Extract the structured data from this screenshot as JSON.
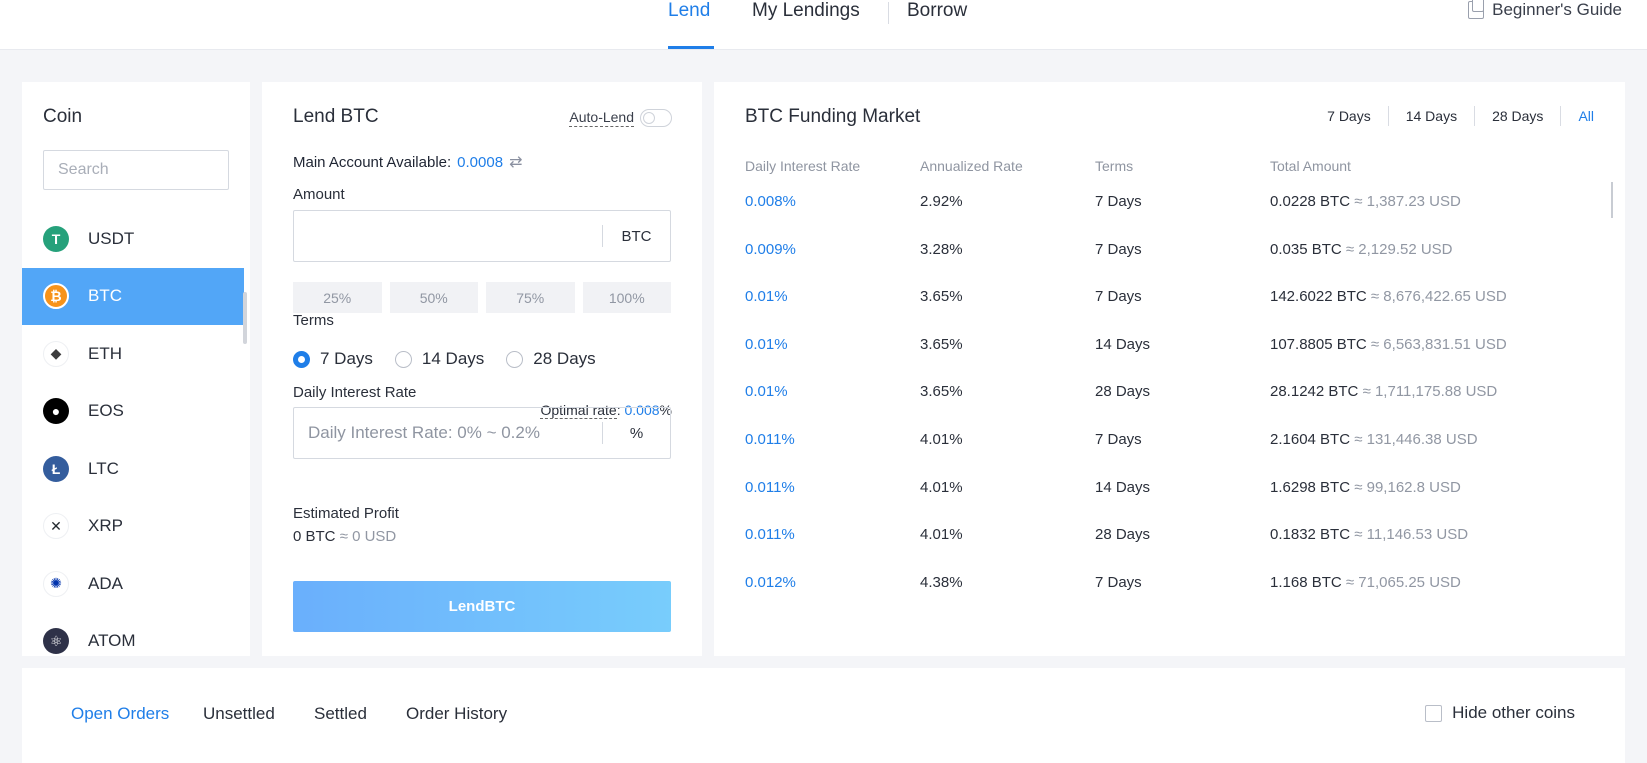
{
  "topnav": {
    "tabs": [
      {
        "label": "Lend",
        "active": true
      },
      {
        "label": "My Lendings",
        "active": false
      },
      {
        "label": "Borrow",
        "active": false
      }
    ],
    "guide_label": "Beginner's Guide"
  },
  "coins": {
    "title": "Coin",
    "search_placeholder": "Search",
    "items": [
      {
        "symbol": "USDT",
        "icon": "usdt-icon",
        "color": "#26a17b"
      },
      {
        "symbol": "BTC",
        "icon": "btc-icon",
        "color": "#f7931a",
        "active": true
      },
      {
        "symbol": "ETH",
        "icon": "eth-icon",
        "color": "#3c3c3d"
      },
      {
        "symbol": "EOS",
        "icon": "eos-icon",
        "color": "#000000"
      },
      {
        "symbol": "LTC",
        "icon": "ltc-icon",
        "color": "#345d9d"
      },
      {
        "symbol": "XRP",
        "icon": "xrp-icon",
        "color": "#23292f"
      },
      {
        "symbol": "ADA",
        "icon": "ada-icon",
        "color": "#0033ad"
      },
      {
        "symbol": "ATOM",
        "icon": "atom-icon",
        "color": "#2e3148"
      }
    ]
  },
  "lend": {
    "title": "Lend BTC",
    "autolend_label": "Auto-Lend",
    "available_label": "Main Account Available:",
    "available_value": "0.0008",
    "amount_label": "Amount",
    "amount_unit": "BTC",
    "percentages": [
      "25%",
      "50%",
      "75%",
      "100%"
    ],
    "terms_label": "Terms",
    "terms": [
      {
        "label": "7 Days",
        "checked": true
      },
      {
        "label": "14 Days",
        "checked": false
      },
      {
        "label": "28 Days",
        "checked": false
      }
    ],
    "rate_label": "Daily Interest Rate",
    "optimal_label": "Optimal rate",
    "optimal_value": "0.008",
    "rate_placeholder": "Daily Interest Rate: 0% ~ 0.2%",
    "rate_unit": "%",
    "profit_label": "Estimated Profit",
    "profit_btc": "0 BTC",
    "profit_usd": "≈ 0 USD",
    "button_label": "LendBTC"
  },
  "market": {
    "title": "BTC Funding Market",
    "ranges": [
      "7 Days",
      "14 Days",
      "28 Days",
      "All"
    ],
    "active_range": "All",
    "columns": [
      "Daily Interest Rate",
      "Annualized Rate",
      "Terms",
      "Total Amount"
    ],
    "rows": [
      {
        "daily": "0.008%",
        "annual": "2.92%",
        "term": "7 Days",
        "amount": "0.0228 BTC",
        "usd": "≈ 1,387.23 USD"
      },
      {
        "daily": "0.009%",
        "annual": "3.28%",
        "term": "7 Days",
        "amount": "0.035 BTC",
        "usd": "≈ 2,129.52 USD"
      },
      {
        "daily": "0.01%",
        "annual": "3.65%",
        "term": "7 Days",
        "amount": "142.6022 BTC",
        "usd": "≈ 8,676,422.65 USD"
      },
      {
        "daily": "0.01%",
        "annual": "3.65%",
        "term": "14 Days",
        "amount": "107.8805 BTC",
        "usd": "≈ 6,563,831.51 USD"
      },
      {
        "daily": "0.01%",
        "annual": "3.65%",
        "term": "28 Days",
        "amount": "28.1242 BTC",
        "usd": "≈ 1,711,175.88 USD"
      },
      {
        "daily": "0.011%",
        "annual": "4.01%",
        "term": "7 Days",
        "amount": "2.1604 BTC",
        "usd": "≈ 131,446.38 USD"
      },
      {
        "daily": "0.011%",
        "annual": "4.01%",
        "term": "14 Days",
        "amount": "1.6298 BTC",
        "usd": "≈ 99,162.8 USD"
      },
      {
        "daily": "0.011%",
        "annual": "4.01%",
        "term": "28 Days",
        "amount": "0.1832 BTC",
        "usd": "≈ 11,146.53 USD"
      },
      {
        "daily": "0.012%",
        "annual": "4.38%",
        "term": "7 Days",
        "amount": "1.168 BTC",
        "usd": "≈ 71,065.25 USD"
      }
    ]
  },
  "orders": {
    "tabs": [
      "Open Orders",
      "Unsettled",
      "Settled",
      "Order History"
    ],
    "active_tab": "Open Orders",
    "hide_label": "Hide other coins"
  }
}
